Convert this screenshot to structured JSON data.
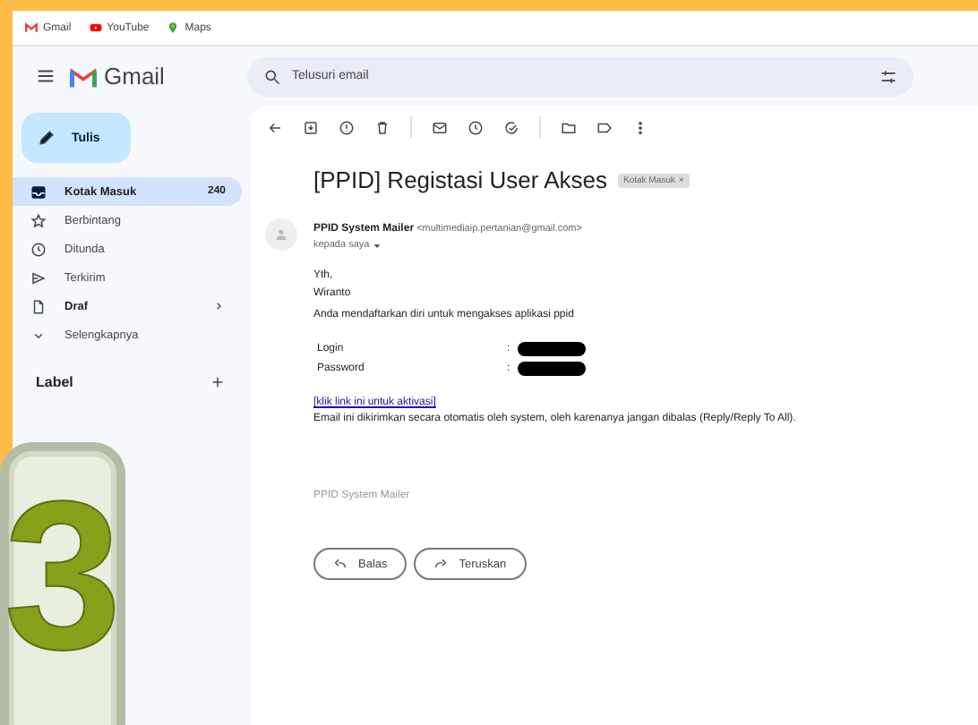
{
  "bookmarks": [
    "Gmail",
    "YouTube",
    "Maps"
  ],
  "app": {
    "name": "Gmail",
    "compose": "Tulis"
  },
  "search": {
    "placeholder": "Telusuri email"
  },
  "sidebar": {
    "items": [
      {
        "label": "Kotak Masuk",
        "count": "240",
        "selected": true,
        "unread": true
      },
      {
        "label": "Berbintang",
        "selected": false,
        "unread": false
      },
      {
        "label": "Ditunda",
        "selected": false,
        "unread": false
      },
      {
        "label": "Terkirim",
        "selected": false,
        "unread": false
      },
      {
        "label": "Draf",
        "selected": false,
        "unread": true,
        "expandable": true
      },
      {
        "label": "Selengkapnya",
        "selected": false,
        "unread": false
      }
    ],
    "labels_heading": "Label"
  },
  "email": {
    "subject": "[PPID] Registasi User Akses",
    "tag": "Kotak Masuk",
    "tag_close": "×",
    "sender": "PPID System Mailer",
    "address": "<multimediaip.pertanian@gmail.com>",
    "recipient": "kepada saya",
    "greeting": "Yth,",
    "name": "Wiranto",
    "intro": "Anda mendaftarkan diri untuk mengakses aplikasi ppid",
    "fields": [
      {
        "label": "Login",
        "separator": ":"
      },
      {
        "label": "Password",
        "separator": ":"
      }
    ],
    "link": "[klik link ini untuk aktivasi]",
    "note": "Email ini dikirimkan secara otomatis oleh system, oleh karenanya jangan dibalas (Reply/Reply To All).",
    "signature": "PPID System Mailer",
    "actions": [
      "Balas",
      "Teruskan"
    ]
  },
  "step_badge": "3"
}
